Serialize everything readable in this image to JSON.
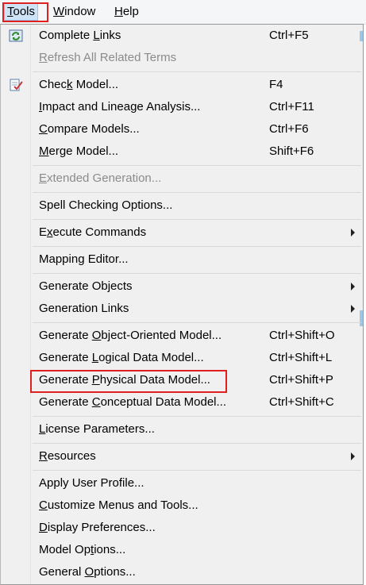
{
  "menubar": {
    "items": [
      {
        "pre": "",
        "mn": "T",
        "post": "ools"
      },
      {
        "pre": "",
        "mn": "W",
        "post": "indow"
      },
      {
        "pre": "",
        "mn": "H",
        "post": "elp"
      }
    ]
  },
  "menu": {
    "groups": [
      [
        {
          "pre": "Complete ",
          "mn": "L",
          "post": "inks",
          "shortcut": "Ctrl+F5",
          "icon": "refresh-links-icon",
          "disabled": false
        },
        {
          "pre": "",
          "mn": "R",
          "post": "efresh All Related Terms",
          "shortcut": "",
          "disabled": true
        }
      ],
      [
        {
          "pre": "Chec",
          "mn": "k",
          "post": " Model...",
          "shortcut": "F4",
          "icon": "check-model-icon",
          "disabled": false
        },
        {
          "pre": "",
          "mn": "I",
          "post": "mpact and Lineage Analysis...",
          "shortcut": "Ctrl+F11",
          "disabled": false
        },
        {
          "pre": "",
          "mn": "C",
          "post": "ompare Models...",
          "shortcut": "Ctrl+F6",
          "disabled": false
        },
        {
          "pre": "",
          "mn": "M",
          "post": "erge Model...",
          "shortcut": "Shift+F6",
          "disabled": false
        }
      ],
      [
        {
          "pre": "",
          "mn": "E",
          "post": "xtended Generation...",
          "shortcut": "",
          "disabled": true
        }
      ],
      [
        {
          "pre": "Spell Checking Options...",
          "mn": "",
          "post": "",
          "shortcut": "",
          "disabled": false
        }
      ],
      [
        {
          "pre": "E",
          "mn": "x",
          "post": "ecute Commands",
          "shortcut": "",
          "submenu": true,
          "disabled": false
        }
      ],
      [
        {
          "pre": "Mapping Editor...",
          "mn": "",
          "post": "",
          "shortcut": "",
          "disabled": false
        }
      ],
      [
        {
          "pre": "Generate Objects",
          "mn": "",
          "post": "",
          "shortcut": "",
          "submenu": true,
          "disabled": false
        },
        {
          "pre": "Generation Links",
          "mn": "",
          "post": "",
          "shortcut": "",
          "submenu": true,
          "disabled": false
        }
      ],
      [
        {
          "pre": "Generate ",
          "mn": "O",
          "post": "bject-Oriented Model...",
          "shortcut": "Ctrl+Shift+O",
          "disabled": false
        },
        {
          "pre": "Generate ",
          "mn": "L",
          "post": "ogical Data Model...",
          "shortcut": "Ctrl+Shift+L",
          "disabled": false
        },
        {
          "pre": "Generate ",
          "mn": "P",
          "post": "hysical Data Model...",
          "shortcut": "Ctrl+Shift+P",
          "disabled": false
        },
        {
          "pre": "Generate ",
          "mn": "C",
          "post": "onceptual Data Model...",
          "shortcut": "Ctrl+Shift+C",
          "disabled": false
        }
      ],
      [
        {
          "pre": "",
          "mn": "L",
          "post": "icense Parameters...",
          "shortcut": "",
          "disabled": false
        }
      ],
      [
        {
          "pre": "",
          "mn": "R",
          "post": "esources",
          "shortcut": "",
          "submenu": true,
          "disabled": false
        }
      ],
      [
        {
          "pre": "Apply User Profile...",
          "mn": "",
          "post": "",
          "shortcut": "",
          "disabled": false
        },
        {
          "pre": "",
          "mn": "C",
          "post": "ustomize Menus and Tools...",
          "shortcut": "",
          "disabled": false
        },
        {
          "pre": "",
          "mn": "D",
          "post": "isplay Preferences...",
          "shortcut": "",
          "disabled": false
        },
        {
          "pre": "Model Op",
          "mn": "t",
          "post": "ions...",
          "shortcut": "",
          "disabled": false
        },
        {
          "pre": "General ",
          "mn": "O",
          "post": "ptions...",
          "shortcut": "",
          "disabled": false
        }
      ]
    ]
  },
  "colors": {
    "highlight_box": "#e02020",
    "menubar_selected": "#cfe3f7"
  }
}
